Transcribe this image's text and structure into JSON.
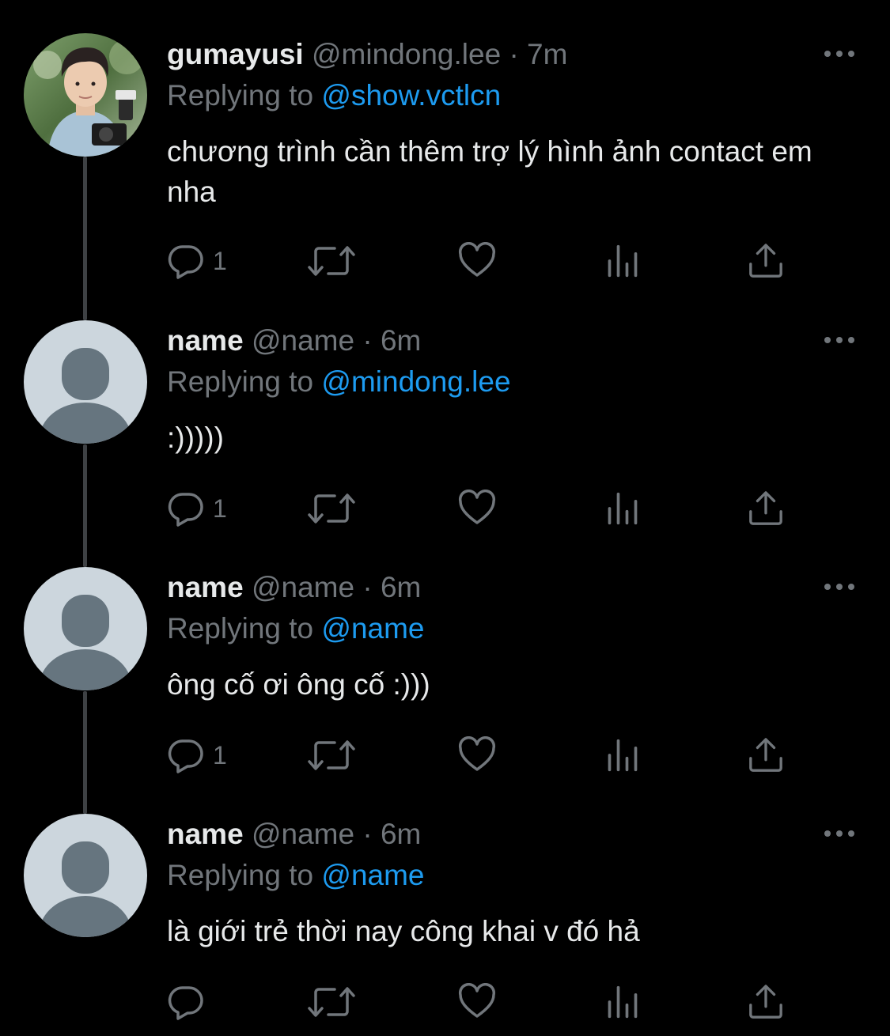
{
  "colors": {
    "background": "#000000",
    "primary_text": "#e7e9ea",
    "secondary_text": "#71767b",
    "link_accent": "#1d9bf0",
    "thread_line": "#3e4144"
  },
  "tweets": [
    {
      "display_name": "gumayusi",
      "handle": "@mindong.lee",
      "dot": "·",
      "time": "7m",
      "replying_prefix": "Replying to",
      "replying_to": "@show.vctlcn",
      "text": "chương trình cần thêm trợ lý hình ảnh contact em nha",
      "reply_count": "1",
      "avatar": "photo-avatar"
    },
    {
      "display_name": "name",
      "handle": "@name",
      "dot": "·",
      "time": "6m",
      "replying_prefix": "Replying to",
      "replying_to": "@mindong.lee",
      "text": ":)))))",
      "reply_count": "1",
      "avatar": "default-avatar"
    },
    {
      "display_name": "name",
      "handle": "@name",
      "dot": "·",
      "time": "6m",
      "replying_prefix": "Replying to",
      "replying_to": "@name",
      "text": "ông cố ơi ông cố :)))",
      "reply_count": "1",
      "avatar": "default-avatar"
    },
    {
      "display_name": "name",
      "handle": "@name",
      "dot": "·",
      "time": "6m",
      "replying_prefix": "Replying to",
      "replying_to": "@name",
      "text": "là giới trẻ thời nay công khai v đó hả",
      "reply_count": "",
      "avatar": "default-avatar"
    }
  ],
  "icons": {
    "more": "more-dots-icon",
    "reply": "reply-bubble-icon",
    "retweet": "retweet-icon",
    "like": "heart-icon",
    "views": "views-bar-chart-icon",
    "share": "share-upload-icon"
  }
}
